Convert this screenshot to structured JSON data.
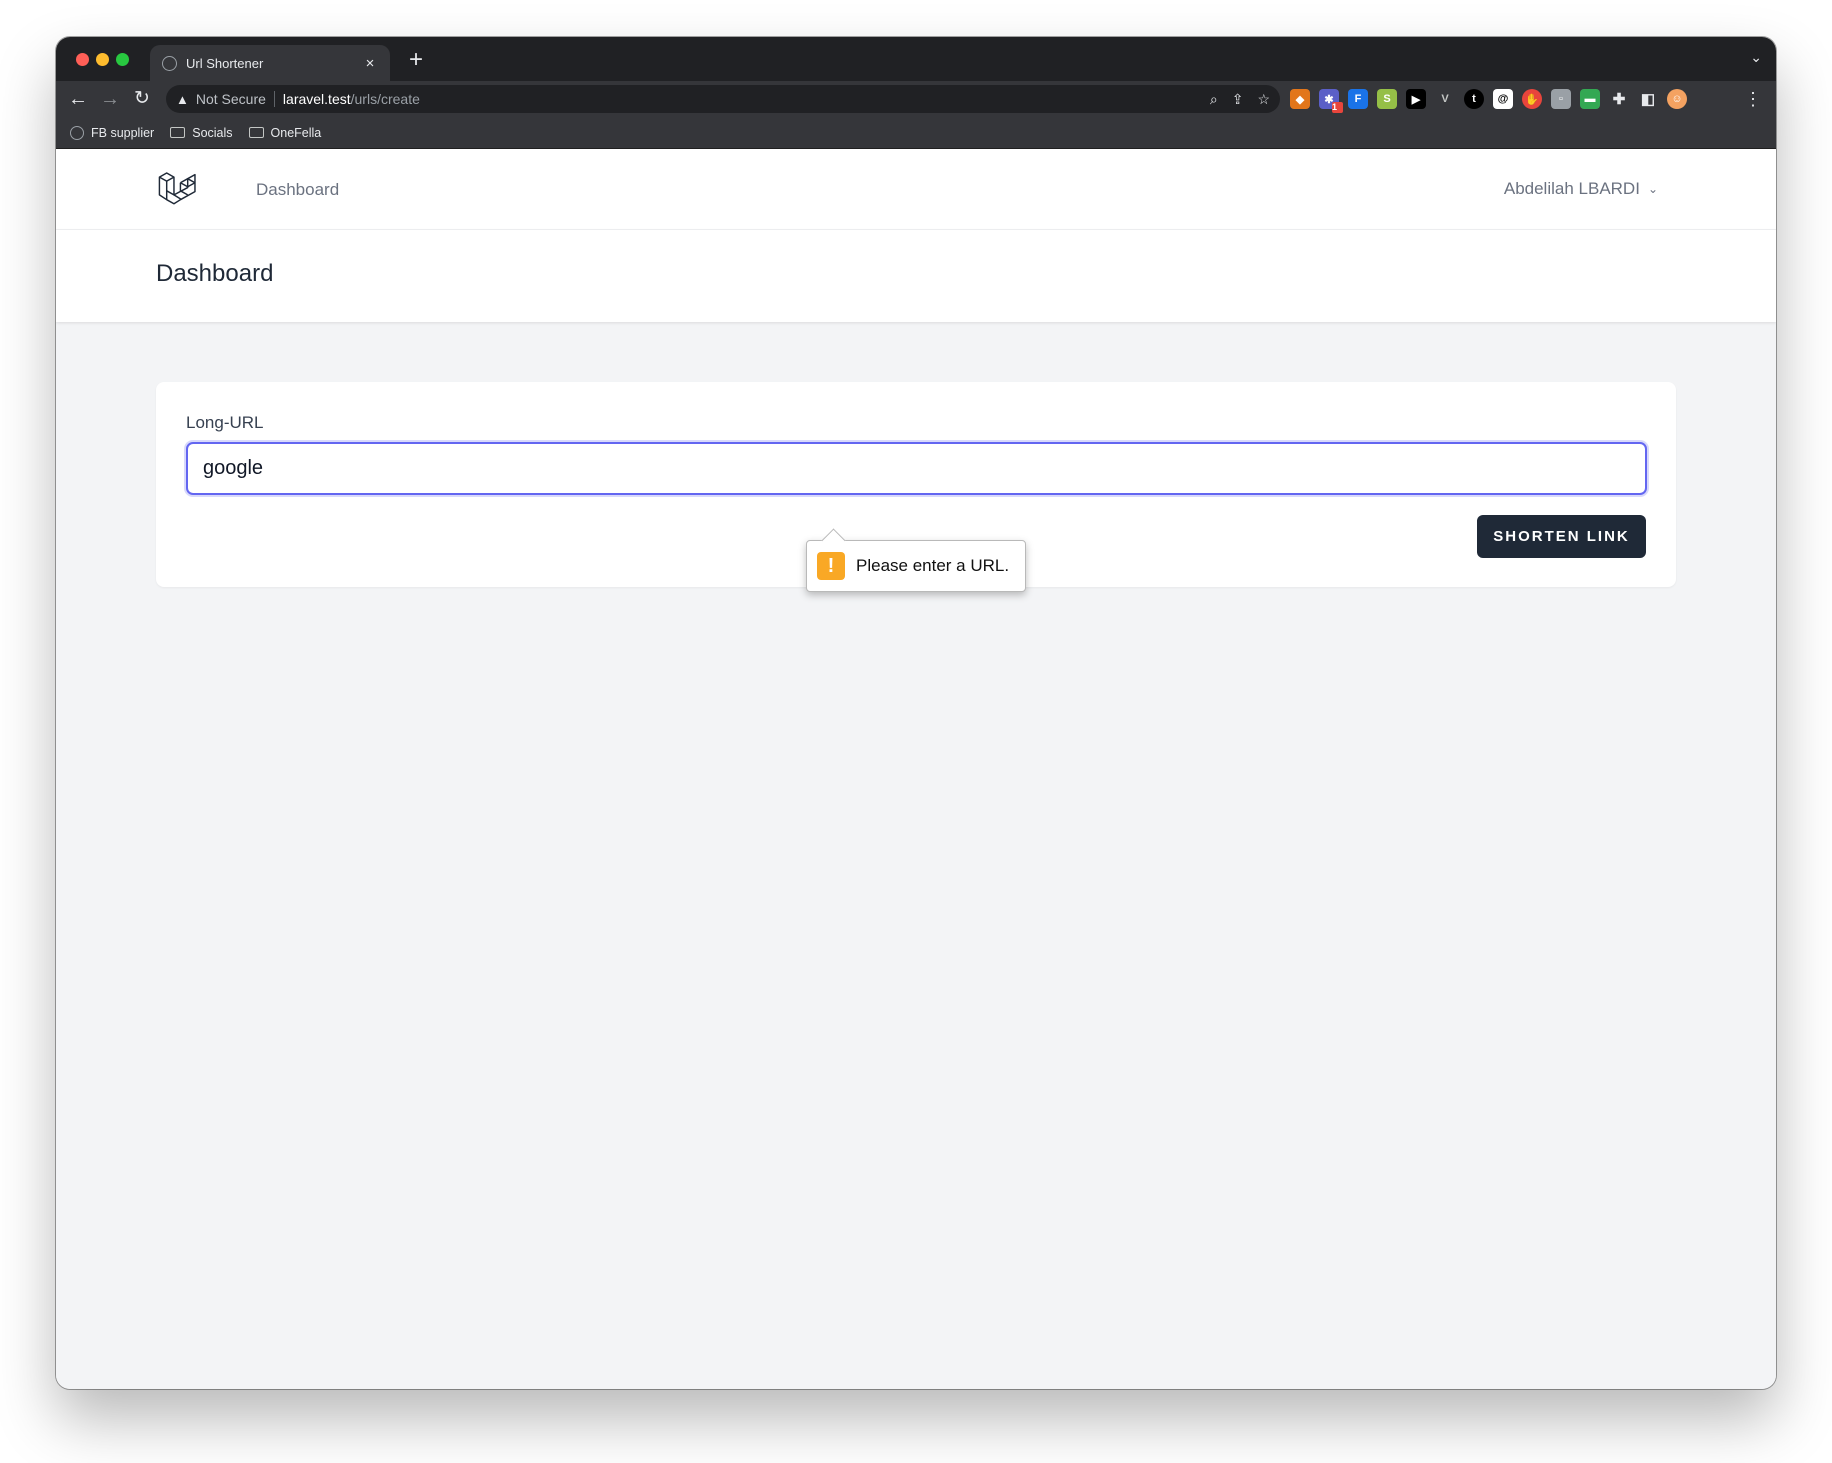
{
  "browser": {
    "tab_title": "Url Shortener",
    "tab_close": "×",
    "new_tab": "+",
    "tab_menu": "⌄",
    "address": {
      "security_label": "Not Secure",
      "host": "laravel.test",
      "path": "/urls/create"
    },
    "bookmarks": [
      "FB supplier",
      "Socials",
      "OneFella"
    ],
    "extension_badge": "1"
  },
  "app": {
    "nav_link": "Dashboard",
    "user_name": "Abdelilah LBARDI",
    "page_title": "Dashboard",
    "form": {
      "label": "Long-URL",
      "value": "google",
      "submit_label": "SHORTEN LINK"
    },
    "validation_message": "Please enter a URL.",
    "validation_icon": "!"
  },
  "colors": {
    "input_focus": "#6366f1",
    "button_bg": "#1f2937",
    "warning_icon": "#f9a825"
  }
}
